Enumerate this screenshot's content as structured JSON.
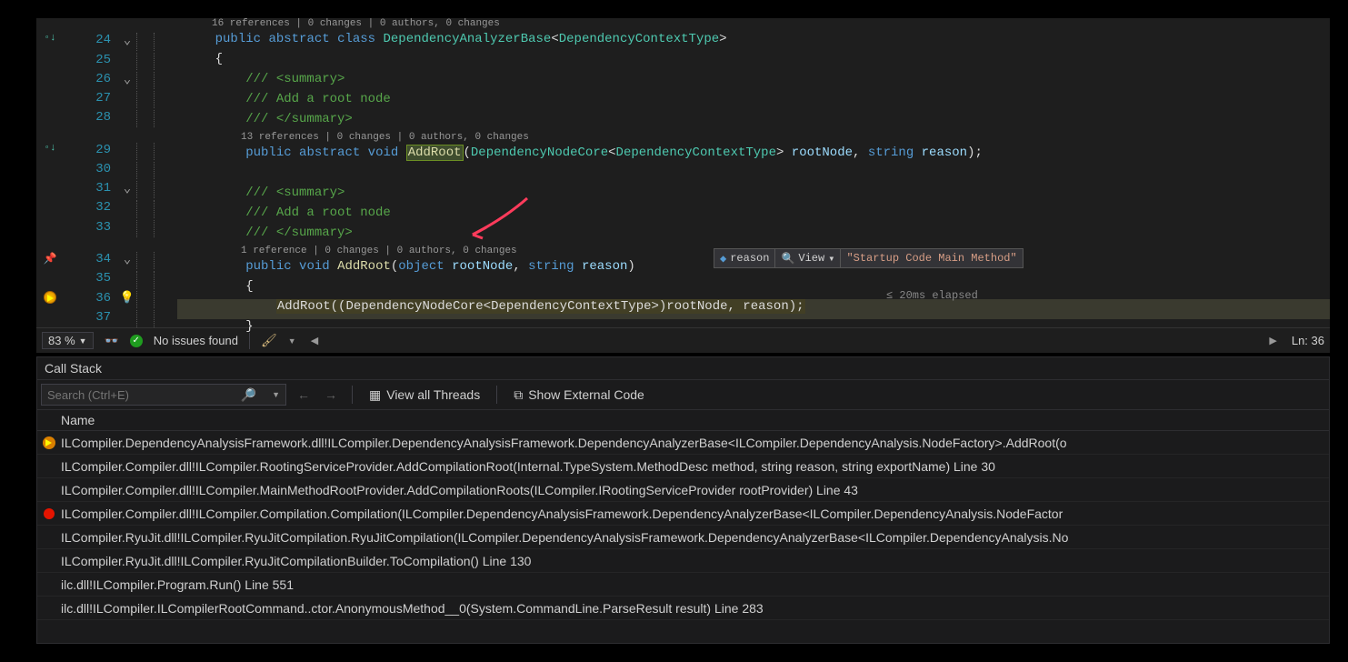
{
  "codelens": {
    "line23": "16 references | 0 changes | 0 authors, 0 changes",
    "line29": "13 references | 0 changes | 0 authors, 0 changes",
    "line34": "1 reference | 0 changes | 0 authors, 0 changes"
  },
  "code": {
    "l24_pre": "    ",
    "l24_public": "public",
    "l24_sp1": " ",
    "l24_abstract": "abstract",
    "l24_sp2": " ",
    "l24_class": "class",
    "l24_sp3": " ",
    "l24_name": "DependencyAnalyzerBase",
    "l24_lt": "<",
    "l24_tp": "DependencyContextType",
    "l24_gt": ">",
    "l25": "    {",
    "l26": "        /// <summary>",
    "l27": "        /// Add a root node",
    "l28": "        /// </summary>",
    "l29_pre": "        ",
    "l29_public": "public",
    "l29_abstract": "abstract",
    "l29_void": "void",
    "l29_method": "AddRoot",
    "l29_open": "(",
    "l29_pty": "DependencyNodeCore",
    "l29_lt": "<",
    "l29_tp": "DependencyContextType",
    "l29_gt": ">",
    "l29_sp": " ",
    "l29_p1": "rootNode",
    "l29_c": ", ",
    "l29_str": "string",
    "l29_sp2": " ",
    "l29_p2": "reason",
    "l29_close": ");",
    "l30": "",
    "l31": "        /// <summary>",
    "l32": "        /// Add a root node",
    "l33": "        /// </summary>",
    "l34_pre": "        ",
    "l34_public": "public",
    "l34_void": "void",
    "l34_method": "AddRoot",
    "l34_open": "(",
    "l34_obj": "object",
    "l34_p1": "rootNode",
    "l34_c": ", ",
    "l34_str": "string",
    "l34_p2": "reason",
    "l34_close": ")",
    "l35": "        {",
    "l36_pre": "            ",
    "l36_call": "AddRoot((DependencyNodeCore<DependencyContextType>)rootNode, reason);",
    "l37": "        }"
  },
  "line_numbers": [
    "24",
    "25",
    "26",
    "27",
    "28",
    "29",
    "30",
    "31",
    "32",
    "33",
    "34",
    "35",
    "36",
    "37"
  ],
  "datatip": {
    "reason_label": "reason",
    "view_label": "View",
    "reason_value": "\"Startup Code Main Method\""
  },
  "perf_tip": "≤ 20ms elapsed",
  "status": {
    "zoom": "83 %",
    "issues": "No issues found",
    "line": "Ln: 36"
  },
  "callstack": {
    "title": "Call Stack",
    "search_placeholder": "Search (Ctrl+E)",
    "btn_threads": "View all Threads",
    "btn_external": "Show External Code",
    "column_name": "Name",
    "rows": [
      "ILCompiler.DependencyAnalysisFramework.dll!ILCompiler.DependencyAnalysisFramework.DependencyAnalyzerBase<ILCompiler.DependencyAnalysis.NodeFactory>.AddRoot(o",
      "ILCompiler.Compiler.dll!ILCompiler.RootingServiceProvider.AddCompilationRoot(Internal.TypeSystem.MethodDesc method, string reason, string exportName) Line 30",
      "ILCompiler.Compiler.dll!ILCompiler.MainMethodRootProvider.AddCompilationRoots(ILCompiler.IRootingServiceProvider rootProvider) Line 43",
      "ILCompiler.Compiler.dll!ILCompiler.Compilation.Compilation(ILCompiler.DependencyAnalysisFramework.DependencyAnalyzerBase<ILCompiler.DependencyAnalysis.NodeFactor",
      "ILCompiler.RyuJit.dll!ILCompiler.RyuJitCompilation.RyuJitCompilation(ILCompiler.DependencyAnalysisFramework.DependencyAnalyzerBase<ILCompiler.DependencyAnalysis.No",
      "ILCompiler.RyuJit.dll!ILCompiler.RyuJitCompilationBuilder.ToCompilation() Line 130",
      "ilc.dll!ILCompiler.Program.Run() Line 551",
      "ilc.dll!ILCompiler.ILCompilerRootCommand..ctor.AnonymousMethod__0(System.CommandLine.ParseResult result) Line 283"
    ]
  }
}
